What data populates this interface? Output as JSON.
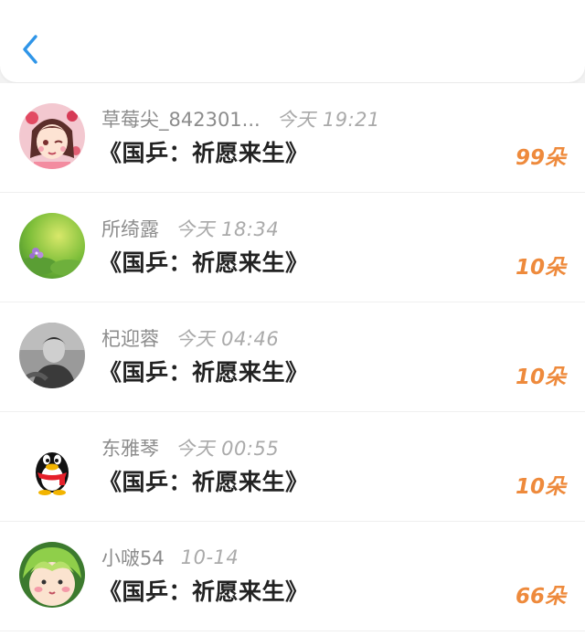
{
  "header": {
    "back_icon": "chevron-left-icon",
    "accent_color": "#2f95e8"
  },
  "list": {
    "amount_color": "#ee8a3c",
    "items": [
      {
        "name": "草莓尖_842301...",
        "time": "今天 19:21",
        "title": "《国乒：祈愿来生》",
        "amount": "99朵",
        "avatar": "anime-girl-avatar"
      },
      {
        "name": "所绮露",
        "time": "今天 18:34",
        "title": "《国乒：祈愿来生》",
        "amount": "10朵",
        "avatar": "green-flower-avatar"
      },
      {
        "name": "杞迎蓉",
        "time": "今天 04:46",
        "title": "《国乒：祈愿来生》",
        "amount": "10朵",
        "avatar": "person-photo-avatar"
      },
      {
        "name": "东雅琴",
        "time": "今天 00:55",
        "title": "《国乒：祈愿来生》",
        "amount": "10朵",
        "avatar": "qq-penguin-avatar"
      },
      {
        "name": "小啵54",
        "time": "10-14",
        "title": "《国乒：祈愿来生》",
        "amount": "66朵",
        "avatar": "cartoon-face-avatar"
      }
    ]
  }
}
